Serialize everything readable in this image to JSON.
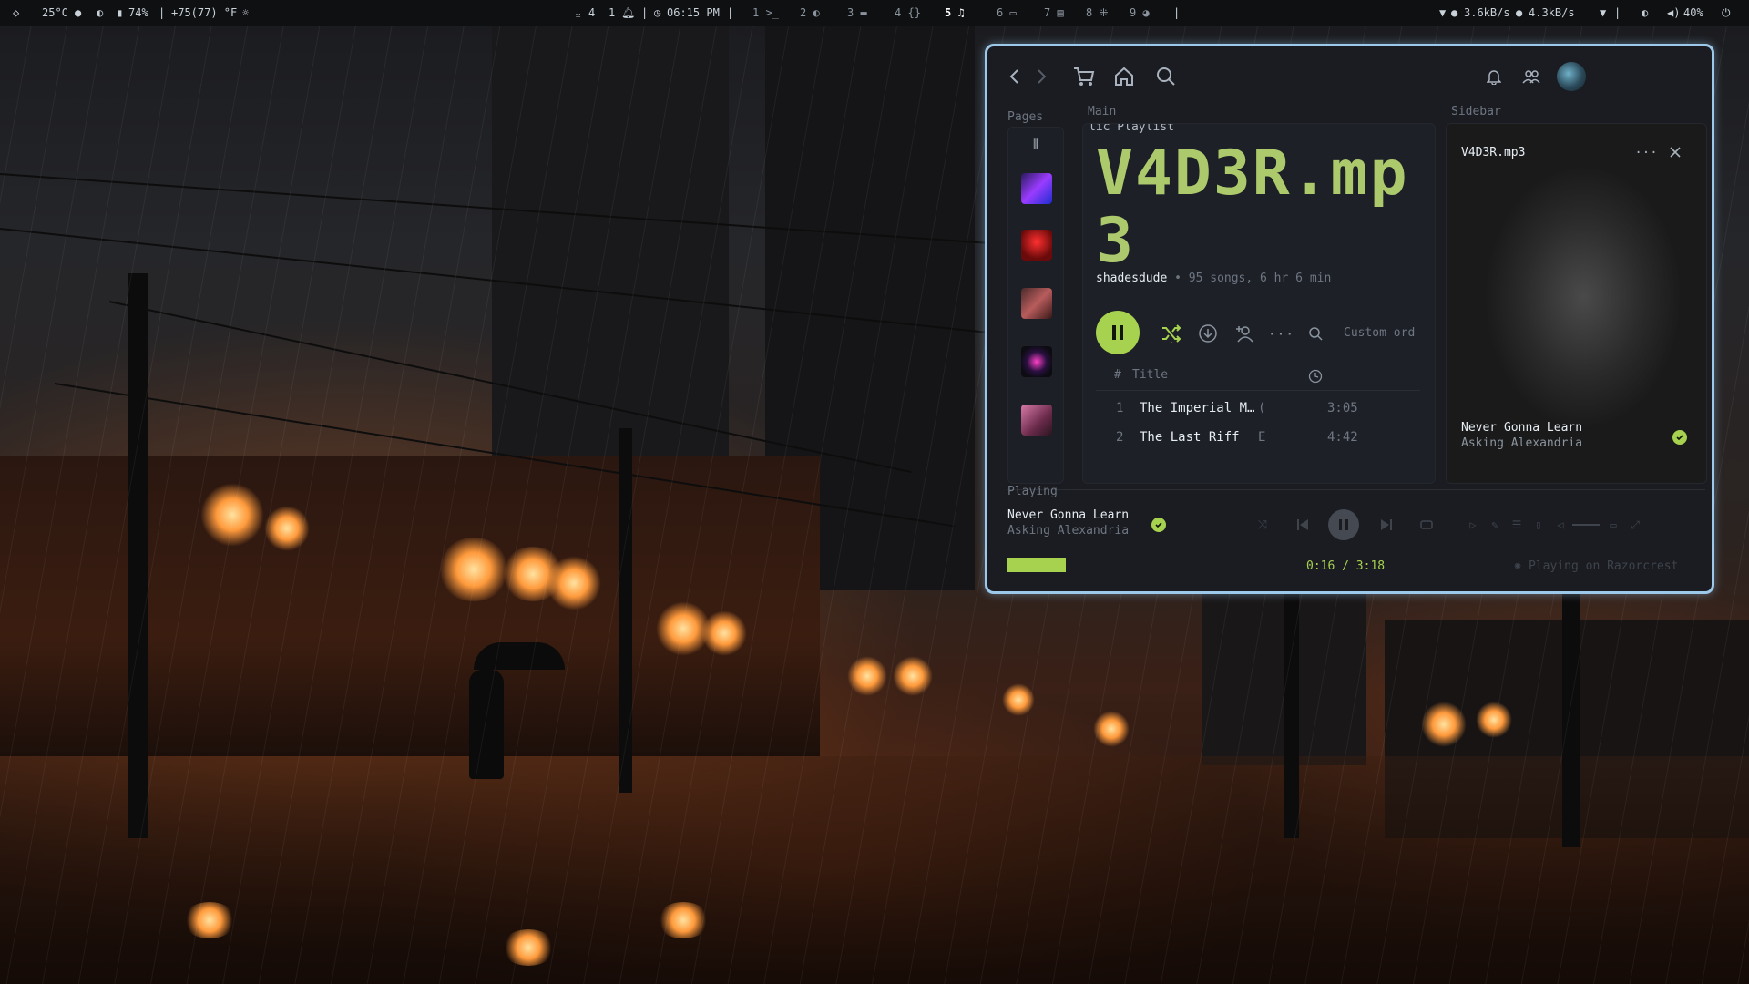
{
  "topbar": {
    "weather": "25°C",
    "battery": "74%",
    "forecast": "+75(77) °F",
    "downloads": "4",
    "notifications": "1",
    "clock": "06:15 PM",
    "workspaces": [
      {
        "num": "1",
        "glyph": ">_"
      },
      {
        "num": "2",
        "glyph": "◐"
      },
      {
        "num": "3",
        "glyph": "▬"
      },
      {
        "num": "4",
        "glyph": "{}"
      },
      {
        "num": "5",
        "glyph": "♫"
      },
      {
        "num": "6",
        "glyph": "▭"
      },
      {
        "num": "7",
        "glyph": "▤"
      },
      {
        "num": "8",
        "glyph": "⁜"
      },
      {
        "num": "9",
        "glyph": "◕"
      }
    ],
    "net_up": "3.6kB/s",
    "net_down": "4.3kB/s",
    "volume": "40%"
  },
  "spotify": {
    "labels": {
      "pages": "Pages",
      "main": "Main",
      "sidebar": "Sidebar",
      "playing": "Playing"
    },
    "playlist": {
      "kind": "lic Playlist",
      "title": "V4D3R.mp3",
      "owner": "shadesdude",
      "meta": "• 95 songs, 6 hr 6 min",
      "sort": "Custom ord",
      "col_num": "#",
      "col_title": "Title",
      "tracks": [
        {
          "num": "1",
          "title": "The Imperial M…",
          "extra": "(",
          "duration": "3:05"
        },
        {
          "num": "2",
          "title": "The Last Riff",
          "extra": "E",
          "duration": "4:42"
        }
      ]
    },
    "sidebar": {
      "title": "V4D3R.mp3",
      "song": "Never Gonna Learn",
      "artist": "Asking Alexandria"
    },
    "now_playing": {
      "song": "Never Gonna Learn",
      "artist": "Asking Alexandria",
      "elapsed": "0:16",
      "separator": "/",
      "total": "3:18",
      "progress": 0.08,
      "device": "Playing on Razorcrest"
    },
    "colors": {
      "accent": "#a7d24f",
      "border": "#9cc8ea"
    }
  }
}
